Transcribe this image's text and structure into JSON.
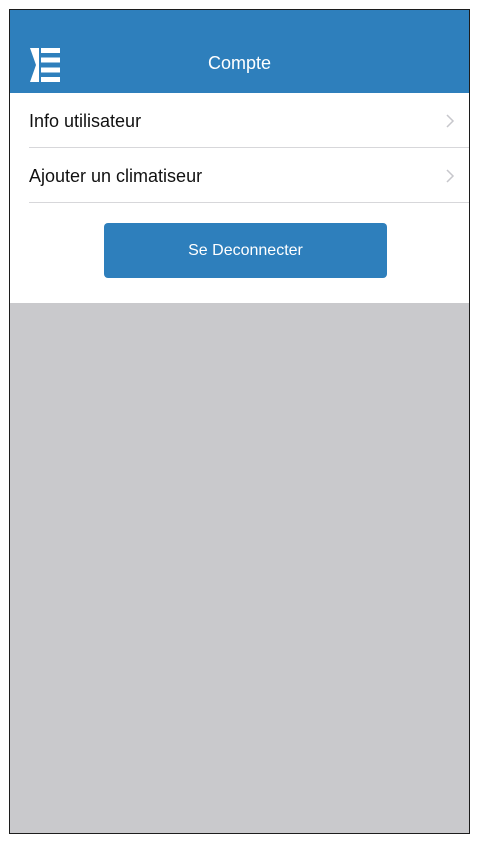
{
  "header": {
    "title": "Compte",
    "menu_icon": "menu-icon",
    "background": "#2e7fbc"
  },
  "list": {
    "items": [
      {
        "label": "Info utilisateur",
        "icon": "chevron-right-icon"
      },
      {
        "label": "Ajouter un climatiseur",
        "icon": "chevron-right-icon"
      }
    ]
  },
  "actions": {
    "logout_label": "Se Deconnecter",
    "accent": "#2e7fbc"
  }
}
